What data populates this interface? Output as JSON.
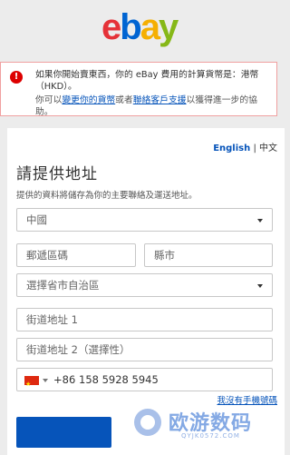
{
  "logo": {
    "letters": [
      "e",
      "b",
      "a",
      "y"
    ],
    "colors": [
      "#e53238",
      "#0064d2",
      "#f5af02",
      "#86b817"
    ]
  },
  "notice": {
    "line1": "如果你開始賣東西，你的 eBay 費用的計算貨幣是：港幣（HKD）。",
    "line2_pre": "你可以",
    "line2_link1": "變更你的貨幣",
    "line2_mid": "或者",
    "line2_link2": "聯絡客戶支援",
    "line2_post": "以獲得進一步的協助。"
  },
  "lang": {
    "english": "English",
    "sep": "|",
    "chinese": "中文"
  },
  "form": {
    "title": "請提供地址",
    "subtitle": "提供的資料將儲存為你的主要聯絡及運送地址。",
    "country": "中國",
    "postcode_placeholder": "郵遞區碼",
    "city_placeholder": "縣市",
    "province_placeholder": "選擇省市自治區",
    "street1_placeholder": "街道地址 1",
    "street2_placeholder": "街道地址 2（選擇性）",
    "phone_code": "+86",
    "phone_number": "158 5928 5945",
    "no_phone_link": "我沒有手機號碼"
  },
  "watermark": {
    "brand": "欧游数码",
    "url": "QYJK0572.COM"
  }
}
